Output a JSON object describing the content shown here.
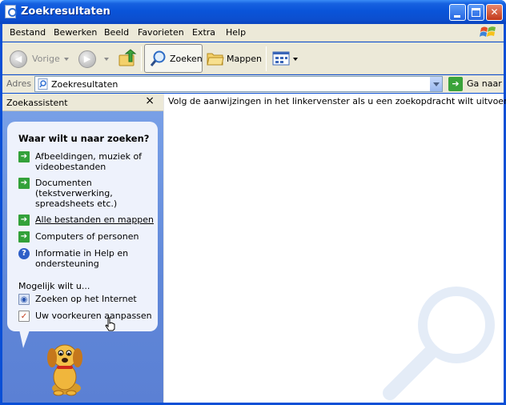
{
  "window": {
    "title": "Zoekresultaten"
  },
  "menubar": {
    "items": [
      "Bestand",
      "Bewerken",
      "Beeld",
      "Favorieten",
      "Extra",
      "Help"
    ]
  },
  "toolbar": {
    "back_label": "Vorige",
    "search_label": "Zoeken",
    "folders_label": "Mappen"
  },
  "address": {
    "label": "Adres",
    "value": "Zoekresultaten",
    "go_label": "Ga naar"
  },
  "search_pane": {
    "header": "Zoekassistent",
    "close": "×",
    "question": "Waar wilt u naar zoeken?",
    "options": [
      {
        "label": "Afbeeldingen, muziek of videobestanden",
        "icon": "green-arrow-icon"
      },
      {
        "label": "Documenten (tekstverwerking, spreadsheets etc.)",
        "icon": "green-arrow-icon"
      },
      {
        "label": "Alle bestanden en mappen",
        "icon": "green-arrow-icon"
      },
      {
        "label": "Computers of personen",
        "icon": "green-arrow-icon"
      },
      {
        "label": "Informatie in Help en ondersteuning",
        "icon": "help-icon"
      }
    ],
    "more_label": "Mogelijk wilt u...",
    "more_options": [
      {
        "label": "Zoeken op het Internet",
        "icon": "internet-search-icon"
      },
      {
        "label": "Uw voorkeuren aanpassen",
        "icon": "preferences-icon"
      }
    ]
  },
  "results": {
    "message": "Volg de aanwijzingen in het linkervenster als u een zoekopdracht wilt uitvoeren"
  },
  "colors": {
    "titlebar": "#0a54d9",
    "pane_bg": "#6f96e4",
    "chrome": "#ece9d8"
  }
}
